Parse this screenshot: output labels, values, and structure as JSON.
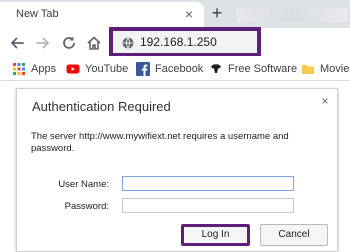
{
  "browser": {
    "tab": {
      "title": "New Tab",
      "close_symbol": "×"
    },
    "new_tab_symbol": "+",
    "toolbar": {
      "back_icon": "back-arrow-icon",
      "forward_icon": "forward-arrow-icon",
      "reload_icon": "reload-icon",
      "home_icon": "home-icon"
    },
    "address_bar": {
      "url": "192.168.1.250",
      "icon": "globe-icon",
      "highlight_color": "#5e1f7a"
    }
  },
  "bookmarks": [
    {
      "label": "Apps",
      "icon": "apps-grid-icon"
    },
    {
      "label": "YouTube",
      "icon": "youtube-icon"
    },
    {
      "label": "Facebook",
      "icon": "facebook-icon"
    },
    {
      "label": "Free Software",
      "icon": "gnu-icon"
    },
    {
      "label": "Movies",
      "icon": "folder-icon"
    }
  ],
  "auth_dialog": {
    "title": "Authentication Required",
    "close_symbol": "×",
    "message": "The server http://www.mywifiext.net  requires a username and password.",
    "username_label": "User Name:",
    "username_value": "",
    "password_label": "Password:",
    "password_value": "",
    "login_label": "Log In",
    "cancel_label": "Cancel"
  }
}
